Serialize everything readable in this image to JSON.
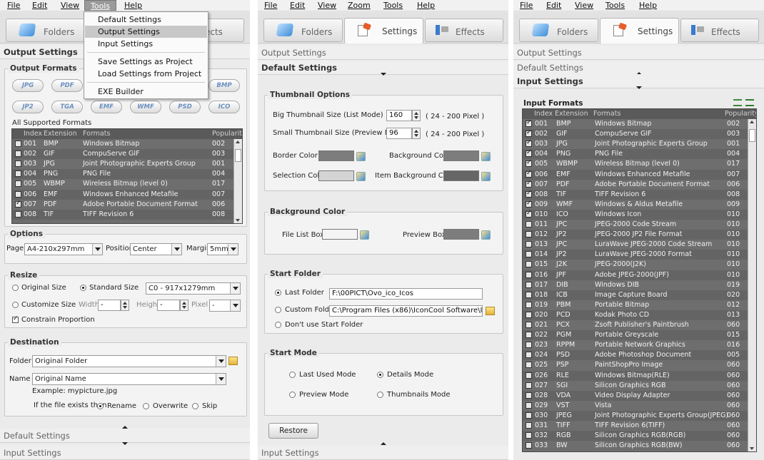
{
  "menus": {
    "p1": [
      "File",
      "Edit",
      "View",
      "Tools",
      "Help"
    ],
    "p2": [
      "File",
      "Edit",
      "View",
      "Zoom",
      "Tools",
      "Help"
    ],
    "p3": [
      "File",
      "Edit",
      "View",
      "Tools",
      "Help"
    ]
  },
  "tabs": {
    "folders": "Folders",
    "settings": "Settings",
    "effects": "Effects",
    "effects_partial": "ects"
  },
  "tools_menu": [
    "Default Settings",
    "Output Settings",
    "Input Settings",
    "Save Settings as Project",
    "Load Settings from Project",
    "EXE Builder"
  ],
  "sections": {
    "output": "Output Settings",
    "default": "Default Settings",
    "input": "Input Settings"
  },
  "p1": {
    "output_formats_title": "Output Formats",
    "formats": [
      "JPG",
      "PDF",
      "BMP",
      "JP2",
      "TGA",
      "EMF",
      "WMF",
      "PSD",
      "ICO"
    ],
    "all_supported": "All Supported Formats",
    "list_headers": [
      "Index",
      "Extension",
      "Formats",
      "Popularity"
    ],
    "rows": [
      {
        "i": "001",
        "e": "BMP",
        "f": "Windows Bitmap",
        "p": "002",
        "c": false
      },
      {
        "i": "002",
        "e": "GIF",
        "f": "CompuServe GIF",
        "p": "003",
        "c": false
      },
      {
        "i": "003",
        "e": "JPG",
        "f": "Joint Photographic Experts Group",
        "p": "001",
        "c": false
      },
      {
        "i": "004",
        "e": "PNG",
        "f": "PNG File",
        "p": "004",
        "c": false
      },
      {
        "i": "005",
        "e": "WBMP",
        "f": "Wireless Bitmap (level 0)",
        "p": "017",
        "c": false
      },
      {
        "i": "006",
        "e": "EMF",
        "f": "Windows Enhanced Metafile",
        "p": "007",
        "c": false
      },
      {
        "i": "007",
        "e": "PDF",
        "f": "Adobe Portable Document Format",
        "p": "006",
        "c": true
      },
      {
        "i": "008",
        "e": "TIF",
        "f": "TIFF Revision 6",
        "p": "008",
        "c": false
      }
    ],
    "options_title": "Options",
    "page_label": "Page",
    "page_value": "A4-210x297mm",
    "position_label": "Position",
    "position_value": "Center",
    "margin_label": "Margin",
    "margin_value": "5mm",
    "resize_title": "Resize",
    "original_size": "Original Size",
    "standard_size": "Standard Size",
    "standard_value": "C0 - 917x1279mm",
    "customize_size": "Customize Size",
    "width": "Width",
    "height": "Height",
    "pixel": "Pixel",
    "width_value": "-",
    "height_value": "-",
    "pixel_value": "-",
    "constrain": "Constrain Proportion",
    "destination_title": "Destination",
    "folder_label": "Folder",
    "folder_value": "Original Folder",
    "name_label": "Name",
    "name_value": "Original Name",
    "example": "Example: mypicture.jpg",
    "exists_label": "If the file exists then",
    "rename": "Rename",
    "overwrite": "Overwrite",
    "skip": "Skip"
  },
  "p2": {
    "thumb_title": "Thumbnail Options",
    "big_label": "Big Thumbnail Size (List Mode)",
    "big_value": "160",
    "big_range": "( 24 - 200 Pixel )",
    "small_label": "Small Thumbnail Size (Preview Mode)",
    "small_value": "96",
    "small_range": "( 24 - 200 Pixel )",
    "border_color": "Border Color",
    "background_color": "Background Color",
    "selection_color": "Selection Color",
    "item_bg_color": "Item Background Color",
    "bgc_title": "Background Color",
    "file_list_box": "File List Box",
    "preview_box": "Preview Box",
    "start_folder_title": "Start Folder",
    "last_folder": "Last Folder",
    "last_folder_value": "F:\\00PICT\\Ovo_ico_Icos",
    "custom_folder": "Custom Folder",
    "custom_folder_value": "C:\\Program Files (x86)\\IconCool Software\\ImageCoo",
    "dont_use": "Don't use Start Folder",
    "start_mode_title": "Start Mode",
    "last_used": "Last Used Mode",
    "details": "Details Mode",
    "preview": "Preview Mode",
    "thumbnails": "Thumbnails Mode",
    "restore": "Restore"
  },
  "p3": {
    "input_formats": "Input Formats",
    "list_headers": [
      "Index",
      "Extension",
      "Formats",
      "Popularity"
    ],
    "rows": [
      {
        "i": "001",
        "e": "BMP",
        "f": "Windows Bitmap",
        "p": "002",
        "c": true
      },
      {
        "i": "002",
        "e": "GIF",
        "f": "CompuServe GIF",
        "p": "003",
        "c": true
      },
      {
        "i": "003",
        "e": "JPG",
        "f": "Joint Photographic Experts Group",
        "p": "001",
        "c": true
      },
      {
        "i": "004",
        "e": "PNG",
        "f": "PNG File",
        "p": "004",
        "c": true
      },
      {
        "i": "005",
        "e": "WBMP",
        "f": "Wireless Bitmap (level 0)",
        "p": "017",
        "c": true
      },
      {
        "i": "006",
        "e": "EMF",
        "f": "Windows Enhanced Metafile",
        "p": "007",
        "c": true
      },
      {
        "i": "007",
        "e": "PDF",
        "f": "Adobe Portable Document Format",
        "p": "006",
        "c": true
      },
      {
        "i": "008",
        "e": "TIF",
        "f": "TIFF Revision 6",
        "p": "008",
        "c": true
      },
      {
        "i": "009",
        "e": "WMF",
        "f": "Windows & Aldus Metafile",
        "p": "009",
        "c": true
      },
      {
        "i": "010",
        "e": "ICO",
        "f": "Windows Icon",
        "p": "010",
        "c": true
      },
      {
        "i": "011",
        "e": "JPC",
        "f": "JPEG-2000 Code Stream",
        "p": "010",
        "c": false
      },
      {
        "i": "012",
        "e": "JP2",
        "f": "JPEG-2000 JP2 File Format",
        "p": "010",
        "c": false
      },
      {
        "i": "013",
        "e": "JPC",
        "f": "LuraWave JPEG-2000 Code Stream",
        "p": "010",
        "c": false
      },
      {
        "i": "014",
        "e": "JP2",
        "f": "LuraWave JPEG-2000 Format",
        "p": "010",
        "c": false
      },
      {
        "i": "015",
        "e": "J2K",
        "f": "JPEG-2000(J2K)",
        "p": "010",
        "c": false
      },
      {
        "i": "016",
        "e": "JPF",
        "f": "Adobe JPEG-2000(JPF)",
        "p": "010",
        "c": false
      },
      {
        "i": "017",
        "e": "DIB",
        "f": "Windows DIB",
        "p": "019",
        "c": false
      },
      {
        "i": "018",
        "e": "ICB",
        "f": "Image Capture Board",
        "p": "020",
        "c": false
      },
      {
        "i": "019",
        "e": "PBM",
        "f": "Portable Bitmap",
        "p": "012",
        "c": false
      },
      {
        "i": "020",
        "e": "PCD",
        "f": "Kodak Photo CD",
        "p": "013",
        "c": false
      },
      {
        "i": "021",
        "e": "PCX",
        "f": "Zsoft Publisher's Paintbrush",
        "p": "060",
        "c": false
      },
      {
        "i": "022",
        "e": "PGM",
        "f": "Portable Greyscale",
        "p": "015",
        "c": false
      },
      {
        "i": "023",
        "e": "RPPM",
        "f": "Portable Network Graphics",
        "p": "016",
        "c": false
      },
      {
        "i": "024",
        "e": "PSD",
        "f": "Adobe Photoshop Document",
        "p": "005",
        "c": false
      },
      {
        "i": "025",
        "e": "PSP",
        "f": "PaintShopPro Image",
        "p": "060",
        "c": false
      },
      {
        "i": "026",
        "e": "RLE",
        "f": "Windows Bitmap(RLE)",
        "p": "060",
        "c": false
      },
      {
        "i": "027",
        "e": "SGI",
        "f": "Silicon Graphics RGB",
        "p": "060",
        "c": false
      },
      {
        "i": "028",
        "e": "VDA",
        "f": "Video Display Adapter",
        "p": "060",
        "c": false
      },
      {
        "i": "029",
        "e": "VST",
        "f": "Vista",
        "p": "060",
        "c": false
      },
      {
        "i": "030",
        "e": "JPEG",
        "f": "Joint Photographic Experts Group(JPEG)",
        "p": "060",
        "c": false
      },
      {
        "i": "031",
        "e": "TIFF",
        "f": "TIFF Revision 6(TIFF)",
        "p": "060",
        "c": false
      },
      {
        "i": "032",
        "e": "RGB",
        "f": "Silicon Graphics RGB(RGB)",
        "p": "060",
        "c": false
      },
      {
        "i": "033",
        "e": "BW",
        "f": "Silicon Graphics RGB(BW)",
        "p": "060",
        "c": false
      }
    ]
  },
  "colors": {
    "list_bg": "#6e6e6e",
    "swatch_gray": "#7d7d7d",
    "swatch_light": "#d4d4d4",
    "swatch_dark": "#666666"
  },
  "icons": [
    "folders-icon",
    "settings-icon",
    "effects-icon",
    "color-picker-icon",
    "browse-folder-icon",
    "select-all-icon"
  ]
}
